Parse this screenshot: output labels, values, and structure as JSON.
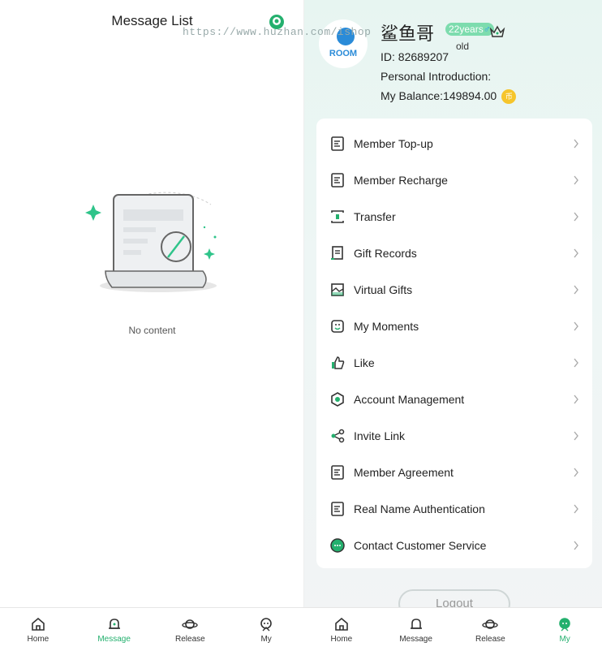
{
  "message_list": {
    "title": "Message List",
    "empty_text": "No content"
  },
  "tabbar": {
    "items": [
      {
        "label": "Home",
        "icon": "home-icon"
      },
      {
        "label": "Message",
        "icon": "bell-icon"
      },
      {
        "label": "Release",
        "icon": "planet-icon"
      },
      {
        "label": "My",
        "icon": "robot-icon"
      }
    ]
  },
  "profile": {
    "avatar_text": "ROOM",
    "username": "鲨鱼哥",
    "age_badge": "22years",
    "age_suffix": "old",
    "gender_symbol": "♂",
    "id_line": "ID:  82689207",
    "intro_line": "Personal Introduction:",
    "balance_line": "My Balance:149894.00",
    "coin_symbol": "币",
    "watermark": "https://www.huzhan.com/ishop",
    "vip_icon": "crown-icon"
  },
  "menu": {
    "items": [
      {
        "label": "Member Top-up",
        "icon": "document-icon"
      },
      {
        "label": "Member Recharge",
        "icon": "document-icon"
      },
      {
        "label": "Transfer",
        "icon": "transfer-icon"
      },
      {
        "label": "Gift Records",
        "icon": "receipt-icon"
      },
      {
        "label": "Virtual Gifts",
        "icon": "gift-box-icon"
      },
      {
        "label": "My Moments",
        "icon": "smile-icon"
      },
      {
        "label": "Like",
        "icon": "thumbs-up-icon"
      },
      {
        "label": "Account Management",
        "icon": "hexagon-icon"
      },
      {
        "label": "Invite Link",
        "icon": "share-icon"
      },
      {
        "label": "Member Agreement",
        "icon": "document-icon"
      },
      {
        "label": "Real Name Authentication",
        "icon": "document-icon"
      },
      {
        "label": "Contact Customer Service",
        "icon": "chat-bubble-icon"
      }
    ]
  },
  "logout_label": "Logout",
  "colors": {
    "accent": "#24b06e",
    "badge": "#7ddcae",
    "coin": "#f6c52b",
    "page_bg": "#eef6f5"
  }
}
